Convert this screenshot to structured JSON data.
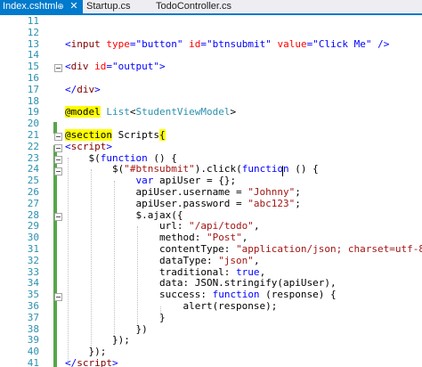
{
  "tabs": [
    {
      "label": "Index.cshtml",
      "active": true
    },
    {
      "label": "Startup.cs",
      "active": false
    },
    {
      "label": "TodoController.cs",
      "active": false
    }
  ],
  "tab_icons": {
    "pin": "pin-icon",
    "close": "close-icon"
  },
  "colors": {
    "accent": "#007acc",
    "line_number": "#2b91af",
    "change_bar": "#57a64a",
    "html_tag": "#800000",
    "html_attr": "#ff0000",
    "string_blue": "#0000ff",
    "js_string": "#a31515",
    "razor_highlight": "#ffff00"
  },
  "code_lines": [
    {
      "num": "11",
      "parts": []
    },
    {
      "num": "12",
      "parts": []
    },
    {
      "num": "13",
      "parts": [
        {
          "t": "<",
          "c": "t-blue"
        },
        {
          "t": "input",
          "c": "t-tag"
        },
        {
          "t": " ",
          "c": "t-plain"
        },
        {
          "t": "type",
          "c": "t-attr"
        },
        {
          "t": "=",
          "c": "t-blue"
        },
        {
          "t": "\"button\"",
          "c": "t-str"
        },
        {
          "t": " ",
          "c": "t-plain"
        },
        {
          "t": "id",
          "c": "t-attr"
        },
        {
          "t": "=",
          "c": "t-blue"
        },
        {
          "t": "\"btnsubmit\"",
          "c": "t-str"
        },
        {
          "t": " ",
          "c": "t-plain"
        },
        {
          "t": "value",
          "c": "t-attr"
        },
        {
          "t": "=",
          "c": "t-blue"
        },
        {
          "t": "\"Click Me\"",
          "c": "t-str"
        },
        {
          "t": " />",
          "c": "t-blue"
        }
      ]
    },
    {
      "num": "14",
      "parts": []
    },
    {
      "num": "15",
      "parts": [
        {
          "t": "<",
          "c": "t-blue"
        },
        {
          "t": "div",
          "c": "t-tag"
        },
        {
          "t": " ",
          "c": "t-plain"
        },
        {
          "t": "id",
          "c": "t-attr"
        },
        {
          "t": "=",
          "c": "t-blue"
        },
        {
          "t": "\"output\"",
          "c": "t-str"
        },
        {
          "t": ">",
          "c": "t-blue"
        }
      ]
    },
    {
      "num": "16",
      "parts": []
    },
    {
      "num": "17",
      "parts": [
        {
          "t": "</",
          "c": "t-blue"
        },
        {
          "t": "div",
          "c": "t-tag"
        },
        {
          "t": ">",
          "c": "t-blue"
        }
      ]
    },
    {
      "num": "18",
      "parts": []
    },
    {
      "num": "19",
      "parts": [
        {
          "t": "@model",
          "c": "t-razor"
        },
        {
          "t": " ",
          "c": "t-plain"
        },
        {
          "t": "List",
          "c": "t-type"
        },
        {
          "t": "<",
          "c": "t-plain"
        },
        {
          "t": "StudentViewModel",
          "c": "t-type"
        },
        {
          "t": ">",
          "c": "t-plain"
        }
      ]
    },
    {
      "num": "20",
      "parts": []
    },
    {
      "num": "21",
      "parts": [
        {
          "t": "@section",
          "c": "t-razor"
        },
        {
          "t": " Scripts",
          "c": "t-plain"
        },
        {
          "t": "{",
          "c": "t-razor"
        }
      ]
    },
    {
      "num": "22",
      "parts": [
        {
          "t": "<",
          "c": "t-blue"
        },
        {
          "t": "script",
          "c": "t-tag"
        },
        {
          "t": ">",
          "c": "t-blue"
        }
      ]
    },
    {
      "num": "23",
      "parts": [
        {
          "t": "    $(",
          "c": "t-plain"
        },
        {
          "t": "function",
          "c": "t-kw"
        },
        {
          "t": " () {",
          "c": "t-plain"
        }
      ]
    },
    {
      "num": "24",
      "parts": [
        {
          "t": "        $(",
          "c": "t-plain"
        },
        {
          "t": "\"#btnsubmit\"",
          "c": "t-js-str"
        },
        {
          "t": ").click(",
          "c": "t-plain"
        },
        {
          "t": "function",
          "c": "t-kw"
        },
        {
          "t": " () {",
          "c": "t-plain"
        }
      ]
    },
    {
      "num": "25",
      "parts": [
        {
          "t": "            ",
          "c": "t-plain"
        },
        {
          "t": "var",
          "c": "t-kw"
        },
        {
          "t": " apiUser = {};",
          "c": "t-plain"
        }
      ]
    },
    {
      "num": "26",
      "parts": [
        {
          "t": "            apiUser.username = ",
          "c": "t-plain"
        },
        {
          "t": "\"Johnny\"",
          "c": "t-js-str"
        },
        {
          "t": ";",
          "c": "t-plain"
        }
      ]
    },
    {
      "num": "27",
      "parts": [
        {
          "t": "            apiUser.password = ",
          "c": "t-plain"
        },
        {
          "t": "\"abc123\"",
          "c": "t-js-str"
        },
        {
          "t": ";",
          "c": "t-plain"
        }
      ]
    },
    {
      "num": "28",
      "parts": [
        {
          "t": "            $.ajax({",
          "c": "t-plain"
        }
      ]
    },
    {
      "num": "29",
      "parts": [
        {
          "t": "                url: ",
          "c": "t-plain"
        },
        {
          "t": "\"/api/todo\"",
          "c": "t-js-str"
        },
        {
          "t": ",",
          "c": "t-plain"
        }
      ]
    },
    {
      "num": "30",
      "parts": [
        {
          "t": "                method: ",
          "c": "t-plain"
        },
        {
          "t": "\"Post\"",
          "c": "t-js-str"
        },
        {
          "t": ",",
          "c": "t-plain"
        }
      ]
    },
    {
      "num": "31",
      "parts": [
        {
          "t": "                contentType: ",
          "c": "t-plain"
        },
        {
          "t": "\"application/json; charset=utf-8\"",
          "c": "t-js-str"
        },
        {
          "t": ",",
          "c": "t-plain"
        }
      ]
    },
    {
      "num": "32",
      "parts": [
        {
          "t": "                dataType: ",
          "c": "t-plain"
        },
        {
          "t": "\"json\"",
          "c": "t-js-str"
        },
        {
          "t": ",",
          "c": "t-plain"
        }
      ]
    },
    {
      "num": "33",
      "parts": [
        {
          "t": "                traditional: ",
          "c": "t-plain"
        },
        {
          "t": "true",
          "c": "t-kw"
        },
        {
          "t": ",",
          "c": "t-plain"
        }
      ]
    },
    {
      "num": "34",
      "parts": [
        {
          "t": "                data: JSON.stringify(apiUser),",
          "c": "t-plain"
        }
      ]
    },
    {
      "num": "35",
      "parts": [
        {
          "t": "                success: ",
          "c": "t-plain"
        },
        {
          "t": "function",
          "c": "t-kw"
        },
        {
          "t": " (response) {",
          "c": "t-plain"
        }
      ]
    },
    {
      "num": "36",
      "parts": [
        {
          "t": "                    alert(response);",
          "c": "t-plain"
        }
      ]
    },
    {
      "num": "37",
      "parts": [
        {
          "t": "                }",
          "c": "t-plain"
        }
      ]
    },
    {
      "num": "38",
      "parts": [
        {
          "t": "            })",
          "c": "t-plain"
        }
      ]
    },
    {
      "num": "39",
      "parts": [
        {
          "t": "        });",
          "c": "t-plain"
        }
      ]
    },
    {
      "num": "40",
      "parts": [
        {
          "t": "    });",
          "c": "t-plain"
        }
      ]
    },
    {
      "num": "41",
      "parts": [
        {
          "t": "</",
          "c": "t-blue"
        },
        {
          "t": "script",
          "c": "t-tag"
        },
        {
          "t": ">",
          "c": "t-blue"
        }
      ]
    }
  ]
}
